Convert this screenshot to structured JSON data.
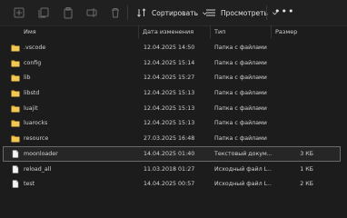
{
  "toolbar": {
    "sort_label": "Сортировать",
    "view_label": "Просмотреть",
    "more_label": "•••",
    "icons": [
      "new-item-icon",
      "copy-icon",
      "paste-icon",
      "rename-icon",
      "share-icon",
      "delete-icon",
      "sort-icon",
      "view-icon"
    ]
  },
  "columns": {
    "name": "Имя",
    "date": "Дата изменения",
    "type": "Тип",
    "size": "Размер"
  },
  "colors": {
    "folder": "#e8b437",
    "background": "#1c1c1c"
  },
  "files": [
    {
      "name": ".vscode",
      "date": "12.04.2025 14:50",
      "type": "Папка с файлами",
      "size": "",
      "kind": "folder"
    },
    {
      "name": "config",
      "date": "12.04.2025 15:14",
      "type": "Папка с файлами",
      "size": "",
      "kind": "folder"
    },
    {
      "name": "lib",
      "date": "12.04.2025 15:27",
      "type": "Папка с файлами",
      "size": "",
      "kind": "folder"
    },
    {
      "name": "libstd",
      "date": "12.04.2025 15:13",
      "type": "Папка с файлами",
      "size": "",
      "kind": "folder"
    },
    {
      "name": "luajit",
      "date": "12.04.2025 15:13",
      "type": "Папка с файлами",
      "size": "",
      "kind": "folder"
    },
    {
      "name": "luarocks",
      "date": "12.04.2025 15:13",
      "type": "Папка с файлами",
      "size": "",
      "kind": "folder"
    },
    {
      "name": "resource",
      "date": "27.03.2025 16:48",
      "type": "Папка с файлами",
      "size": "",
      "kind": "folder"
    },
    {
      "name": "moonloader",
      "date": "14.04.2025 01:40",
      "type": "Текстовый докум...",
      "size": "3 КБ",
      "kind": "file",
      "selected": true
    },
    {
      "name": "reload_all",
      "date": "11.03.2018 01:27",
      "type": "Исходный файл L...",
      "size": "1 КБ",
      "kind": "file"
    },
    {
      "name": "test",
      "date": "14.04.2025 00:57",
      "type": "Исходный файл L...",
      "size": "2 КБ",
      "kind": "file"
    }
  ]
}
